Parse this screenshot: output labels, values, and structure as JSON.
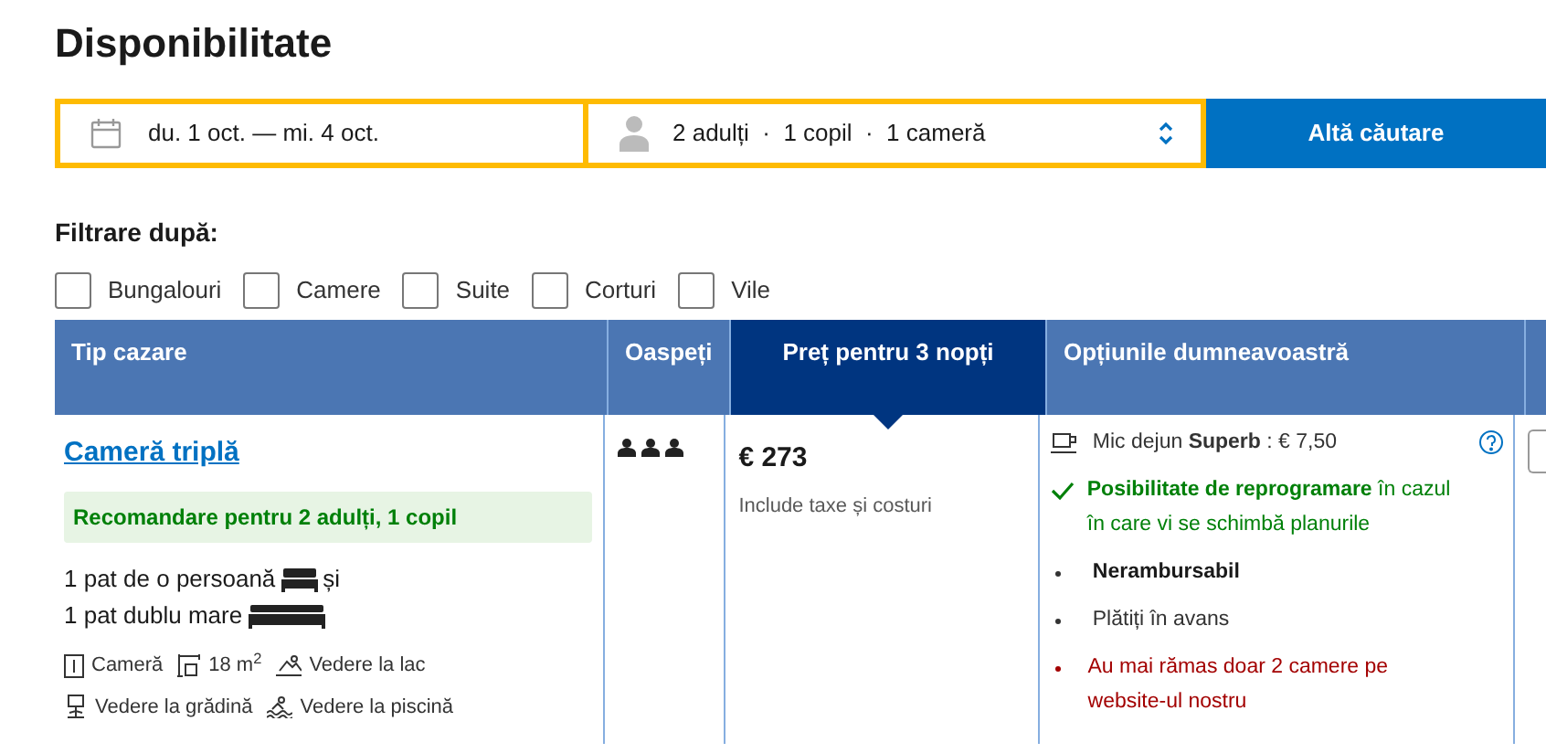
{
  "title": "Disponibilitate",
  "search": {
    "dates": "du. 1 oct. — mi. 4 oct.",
    "guests": "2 adulți  ·  1 copil  ·  1 cameră",
    "button": "Altă căutare"
  },
  "filters": {
    "label": "Filtrare după:",
    "options": [
      {
        "label": "Bungalouri",
        "checked": false
      },
      {
        "label": "Camere",
        "checked": false
      },
      {
        "label": "Suite",
        "checked": false
      },
      {
        "label": "Corturi",
        "checked": false
      },
      {
        "label": "Vile",
        "checked": false
      }
    ]
  },
  "table": {
    "columns": [
      {
        "label": "Tip cazare",
        "selected": false
      },
      {
        "label": "Oaspeți",
        "selected": false
      },
      {
        "label": "Preț pentru 3 nopți",
        "selected": true
      },
      {
        "label": "Opțiunile dumneavoastră",
        "selected": false
      }
    ],
    "rows": [
      {
        "name": "Cameră triplă",
        "recommendation": "Recomandare pentru 2 adulți, 1 copil",
        "beds": [
          {
            "text": "1 pat de o persoană",
            "kind": "single",
            "conjunction": "și"
          },
          {
            "text": "1 pat dublu mare",
            "kind": "double"
          }
        ],
        "features": [
          {
            "kind": "room",
            "text": "Cameră"
          },
          {
            "kind": "size",
            "text": "18 m$^{2}$"
          },
          {
            "kind": "view",
            "text": "Vedere la lac"
          },
          {
            "kind": "garden",
            "text": "Vedere la grădină"
          },
          {
            "kind": "pool",
            "text": "Vedere la piscină"
          }
        ],
        "price": "€ 273",
        "price_note": "Include taxe și costuri",
        "options": [
          {
            "kind": "breakfast",
            "text": "Mic dejun **Superb** : € 7,50"
          },
          {
            "kind": "flexible",
            "text": "**Posibilitate de reprogramare** în cazul în care vi se schimbă planurile"
          },
          {
            "kind": "bullet",
            "text": "Nerambursabil",
            "bold": true
          },
          {
            "kind": "bullet",
            "text": "Plătiți în avans",
            "bold": false
          },
          {
            "kind": "warning",
            "text": "Au mai rămas doar 2 camere pe website-ul nostru"
          }
        ]
      }
    ]
  }
}
